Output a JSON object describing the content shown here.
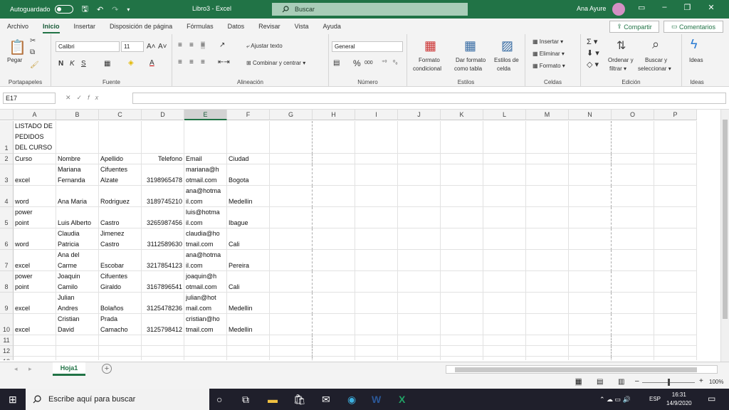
{
  "titlebar": {
    "autosave": "Autoguardado",
    "doc_title": "Libro3  -  Excel",
    "search": "Buscar",
    "user": "Ana Ayure"
  },
  "menu": {
    "items": [
      "Archivo",
      "Inicio",
      "Insertar",
      "Disposición de página",
      "Fórmulas",
      "Datos",
      "Revisar",
      "Vista",
      "Ayuda"
    ],
    "share": "Compartir",
    "comments": "Comentarios"
  },
  "ribbon": {
    "portapapeles": {
      "paste": "Pegar",
      "label": "Portapapeles"
    },
    "fuente": {
      "font": "Calibri",
      "size": "11",
      "label": "Fuente"
    },
    "alineacion": {
      "wrap": "Ajustar texto",
      "merge": "Combinar y centrar",
      "label": "Alineación"
    },
    "numero": {
      "format": "General",
      "label": "Número"
    },
    "estilos": {
      "cond1": "Formato",
      "cond2": "condicional",
      "table1": "Dar formato",
      "table2": "como tabla",
      "cell1": "Estilos de",
      "cell2": "celda",
      "label": "Estilos"
    },
    "celdas": {
      "insert": "Insertar",
      "delete": "Eliminar",
      "format": "Formato",
      "label": "Celdas"
    },
    "edicion": {
      "sort1": "Ordenar y",
      "sort2": "filtrar",
      "find1": "Buscar y",
      "find2": "seleccionar",
      "label": "Edición"
    },
    "ideas": {
      "btn": "Ideas",
      "label": "Ideas"
    }
  },
  "formula_bar": {
    "name_box": "E17",
    "fx": "fx",
    "value": ""
  },
  "columns": [
    "A",
    "B",
    "C",
    "D",
    "E",
    "F",
    "G",
    "H",
    "I",
    "J",
    "K",
    "L",
    "M",
    "N",
    "O",
    "P"
  ],
  "rows": [
    {
      "num": "1",
      "cells": [
        "LISTADO DE\nPEDIDOS\nDEL CURSO",
        "",
        "",
        "",
        "",
        ""
      ]
    },
    {
      "num": "2",
      "cells": [
        "Curso",
        "Nombre",
        "Apellido",
        "Telefono",
        "Email",
        "Ciudad"
      ]
    },
    {
      "num": "3",
      "cells": [
        "\nexcel",
        "Mariana\nFernanda",
        "Cifuentes\nAlzate",
        "\n3198965478",
        "mariana@h\notmail.com",
        "\nBogota"
      ]
    },
    {
      "num": "4",
      "cells": [
        "\nword",
        "\nAna Maria",
        "\nRodriguez",
        "\n3189745210",
        "ana@hotma\nil.com",
        "\nMedellin"
      ]
    },
    {
      "num": "5",
      "cells": [
        "power\npoint",
        "\nLuis Alberto",
        "\nCastro",
        "\n3265987456",
        "luis@hotma\nil.com",
        "\nIbague"
      ]
    },
    {
      "num": "6",
      "cells": [
        "\nword",
        "Claudia\nPatricia",
        "Jimenez\nCastro",
        "\n3112589630",
        "claudia@ho\ntmail.com",
        "\nCali"
      ]
    },
    {
      "num": "7",
      "cells": [
        "\nexcel",
        "Ana del\nCarme",
        "\nEscobar",
        "\n3217854123",
        "ana@hotma\nil.com",
        "\nPereira"
      ]
    },
    {
      "num": "8",
      "cells": [
        "power\npoint",
        "Joaquin\nCamilo",
        "Cifuentes\nGiraldo",
        "\n3167896541",
        "joaquin@h\notmail.com",
        "\nCali"
      ]
    },
    {
      "num": "9",
      "cells": [
        "\nexcel",
        "Julian\nAndres",
        "\nBolaños",
        "\n3125478236",
        "julian@hot\nmail.com",
        "\nMedellin"
      ]
    },
    {
      "num": "10",
      "cells": [
        "\nexcel",
        "Cristian\nDavid",
        "Prada\nCamacho",
        "\n3125798412",
        "cristian@ho\ntmail.com",
        "\nMedellin"
      ]
    },
    {
      "num": "11",
      "cells": [
        "",
        "",
        "",
        "",
        "",
        ""
      ]
    },
    {
      "num": "12",
      "cells": [
        "",
        "",
        "",
        "",
        "",
        ""
      ]
    },
    {
      "num": "13",
      "cells": [
        "",
        "",
        "",
        "",
        "",
        ""
      ]
    }
  ],
  "sheet": {
    "tab": "Hoja1",
    "add": "+"
  },
  "status": {
    "zoom": "100%"
  },
  "taskbar": {
    "search": "Escribe aquí para buscar",
    "lang": "ESP",
    "time": "16:31",
    "date": "14/9/2020"
  }
}
